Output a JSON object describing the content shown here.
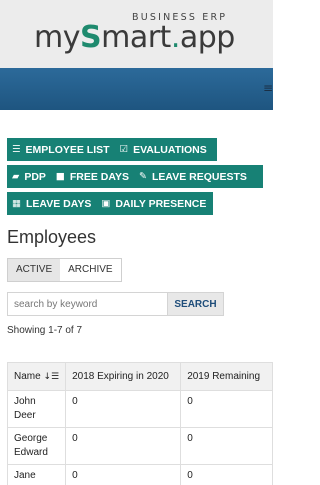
{
  "header": {
    "logo_sub": "BUSINESS ERP",
    "logo_prefix": "my",
    "logo_s": "S",
    "logo_mid": "mart",
    "logo_dot": ".",
    "logo_suffix": "app",
    "menu_icon": "hamburger-icon",
    "menu_glyph": "≡"
  },
  "nav_buttons": [
    {
      "label": "EMPLOYEE LIST",
      "icon": "list-icon",
      "glyph": "☰"
    },
    {
      "label": "EVALUATIONS",
      "icon": "check-square-icon",
      "glyph": "☑"
    },
    {
      "label": "PDP",
      "icon": "book-icon",
      "glyph": "▰"
    },
    {
      "label": "FREE DAYS",
      "icon": "suitcase-icon",
      "glyph": "■"
    },
    {
      "label": "LEAVE REQUESTS",
      "icon": "edit-icon",
      "glyph": "✎"
    },
    {
      "label": "LEAVE DAYS",
      "icon": "calendar-icon",
      "glyph": "▦"
    },
    {
      "label": "DAILY PRESENCE",
      "icon": "calendar-icon",
      "glyph": "▣"
    }
  ],
  "page_title": "Employees",
  "tabs": {
    "active": "ACTIVE",
    "archive": "ARCHIVE"
  },
  "search": {
    "placeholder": "search by keyword",
    "button": "SEARCH"
  },
  "showing": "Showing 1-7 of 7",
  "table": {
    "headers": [
      "Name",
      "2018 Expiring in 2020",
      "2019 Remaining"
    ],
    "sort_icon": "sort-icon",
    "sort_glyph": "↓☰",
    "rows": [
      [
        "John Deer",
        "0",
        "0"
      ],
      [
        "George Edward",
        "0",
        "0"
      ],
      [
        "Jane",
        "0",
        "0"
      ]
    ]
  },
  "colors": {
    "accent": "#178175",
    "navbar": "#1e5580",
    "header_bg": "#ececec"
  }
}
